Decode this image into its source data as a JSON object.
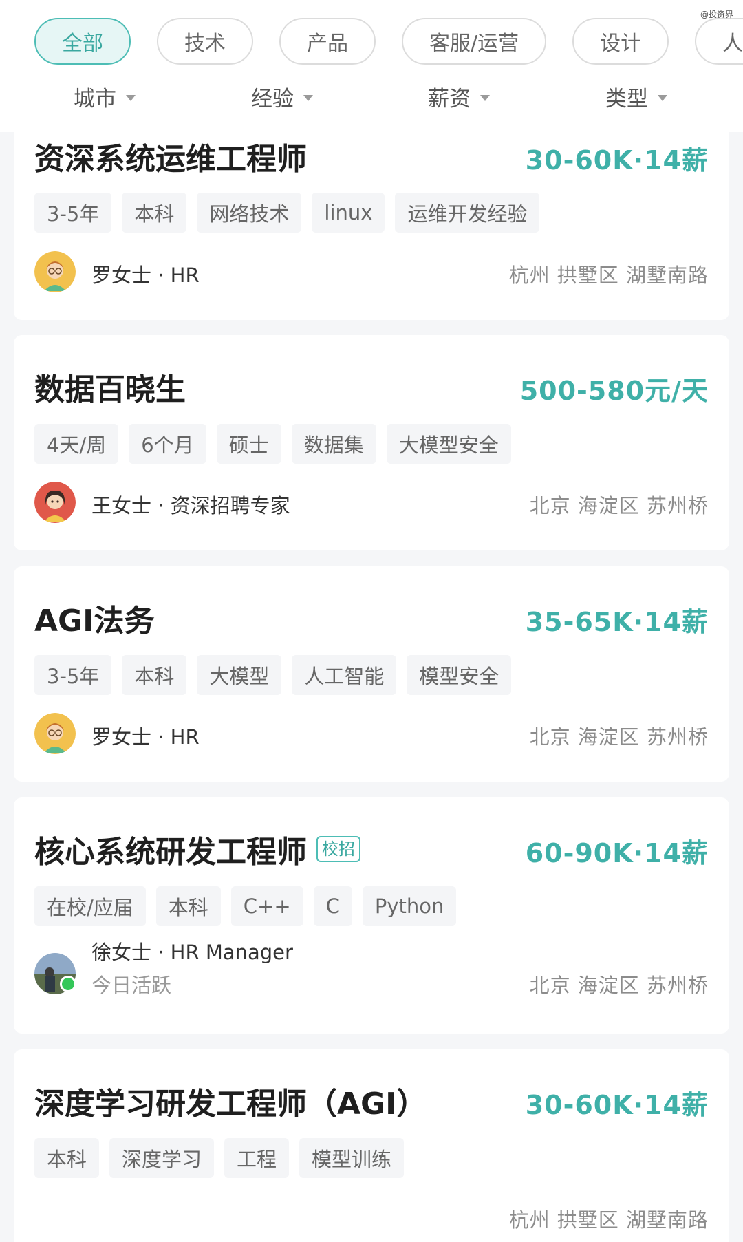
{
  "watermark": "@投资界",
  "categories": [
    "全部",
    "技术",
    "产品",
    "客服/运营",
    "设计",
    "人力"
  ],
  "filters": [
    "城市",
    "经验",
    "薪资",
    "类型"
  ],
  "colors": {
    "accent": "#3fb0a8",
    "chip_active_bg": "#e6f6f5",
    "online": "#34c759"
  },
  "jobs": [
    {
      "title": "资深系统运维工程师",
      "salary": "30-60K·14薪",
      "tags": [
        "3-5年",
        "本科",
        "网络技术",
        "linux",
        "运维开发经验"
      ],
      "recruiter": "罗女士 · HR",
      "location": "杭州 拱墅区 湖墅南路",
      "avatar_icon": "female-avatar-glasses-icon"
    },
    {
      "title": "数据百晓生",
      "salary": "500-580元/天",
      "tags": [
        "4天/周",
        "6个月",
        "硕士",
        "数据集",
        "大模型安全"
      ],
      "recruiter": "王女士 · 资深招聘专家",
      "location": "北京 海淀区 苏州桥",
      "avatar_icon": "female-avatar-icon"
    },
    {
      "title": "AGI法务",
      "salary": "35-65K·14薪",
      "tags": [
        "3-5年",
        "本科",
        "大模型",
        "人工智能",
        "模型安全"
      ],
      "recruiter": "罗女士 · HR",
      "location": "北京 海淀区 苏州桥",
      "avatar_icon": "female-avatar-glasses-icon"
    },
    {
      "title": "核心系统研发工程师",
      "badge": "校招",
      "salary": "60-90K·14薪",
      "tags": [
        "在校/应届",
        "本科",
        "C++",
        "C",
        "Python"
      ],
      "recruiter": "徐女士 · HR Manager",
      "status": "今日活跃",
      "location": "北京 海淀区 苏州桥",
      "avatar_icon": "photo-avatar-icon"
    },
    {
      "title": "深度学习研发工程师（AGI）",
      "salary": "30-60K·14薪",
      "tags": [
        "本科",
        "深度学习",
        "工程",
        "模型训练"
      ],
      "location": "杭州 拱墅区 湖墅南路"
    }
  ]
}
